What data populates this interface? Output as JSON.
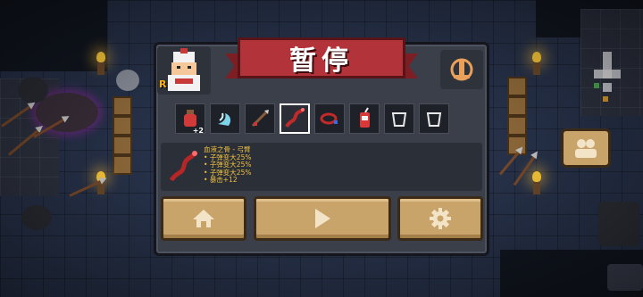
{
  "pause_menu": {
    "title": "暂停",
    "character_rank": "R",
    "items": [
      {
        "icon": "potion-plus-icon",
        "badge": "+2"
      },
      {
        "icon": "wind-wave-icon",
        "badge": ""
      },
      {
        "icon": "spear-icon",
        "badge": ""
      },
      {
        "icon": "blood-whip-icon",
        "badge": "",
        "selected": true
      },
      {
        "icon": "red-ring-icon",
        "badge": ""
      },
      {
        "icon": "red-can-icon",
        "badge": ""
      },
      {
        "icon": "empty-cup-icon",
        "badge": ""
      },
      {
        "icon": "empty-cup-icon",
        "badge": ""
      }
    ],
    "selected_info": {
      "name": "血液之骨 - 弓臂",
      "lines": [
        "子弹变大25%",
        "子弹变大25%",
        "子弹变大25%",
        "暴击+12"
      ]
    },
    "buttons": {
      "home": "home-icon",
      "resume": "play-icon",
      "settings": "gear-icon"
    }
  },
  "hud": {
    "team_button": "team-icon"
  },
  "colors": {
    "panel": "#3a3f4a",
    "banner": "#b2343a",
    "button": "#c9a46a",
    "info_text": "#f0c040"
  }
}
